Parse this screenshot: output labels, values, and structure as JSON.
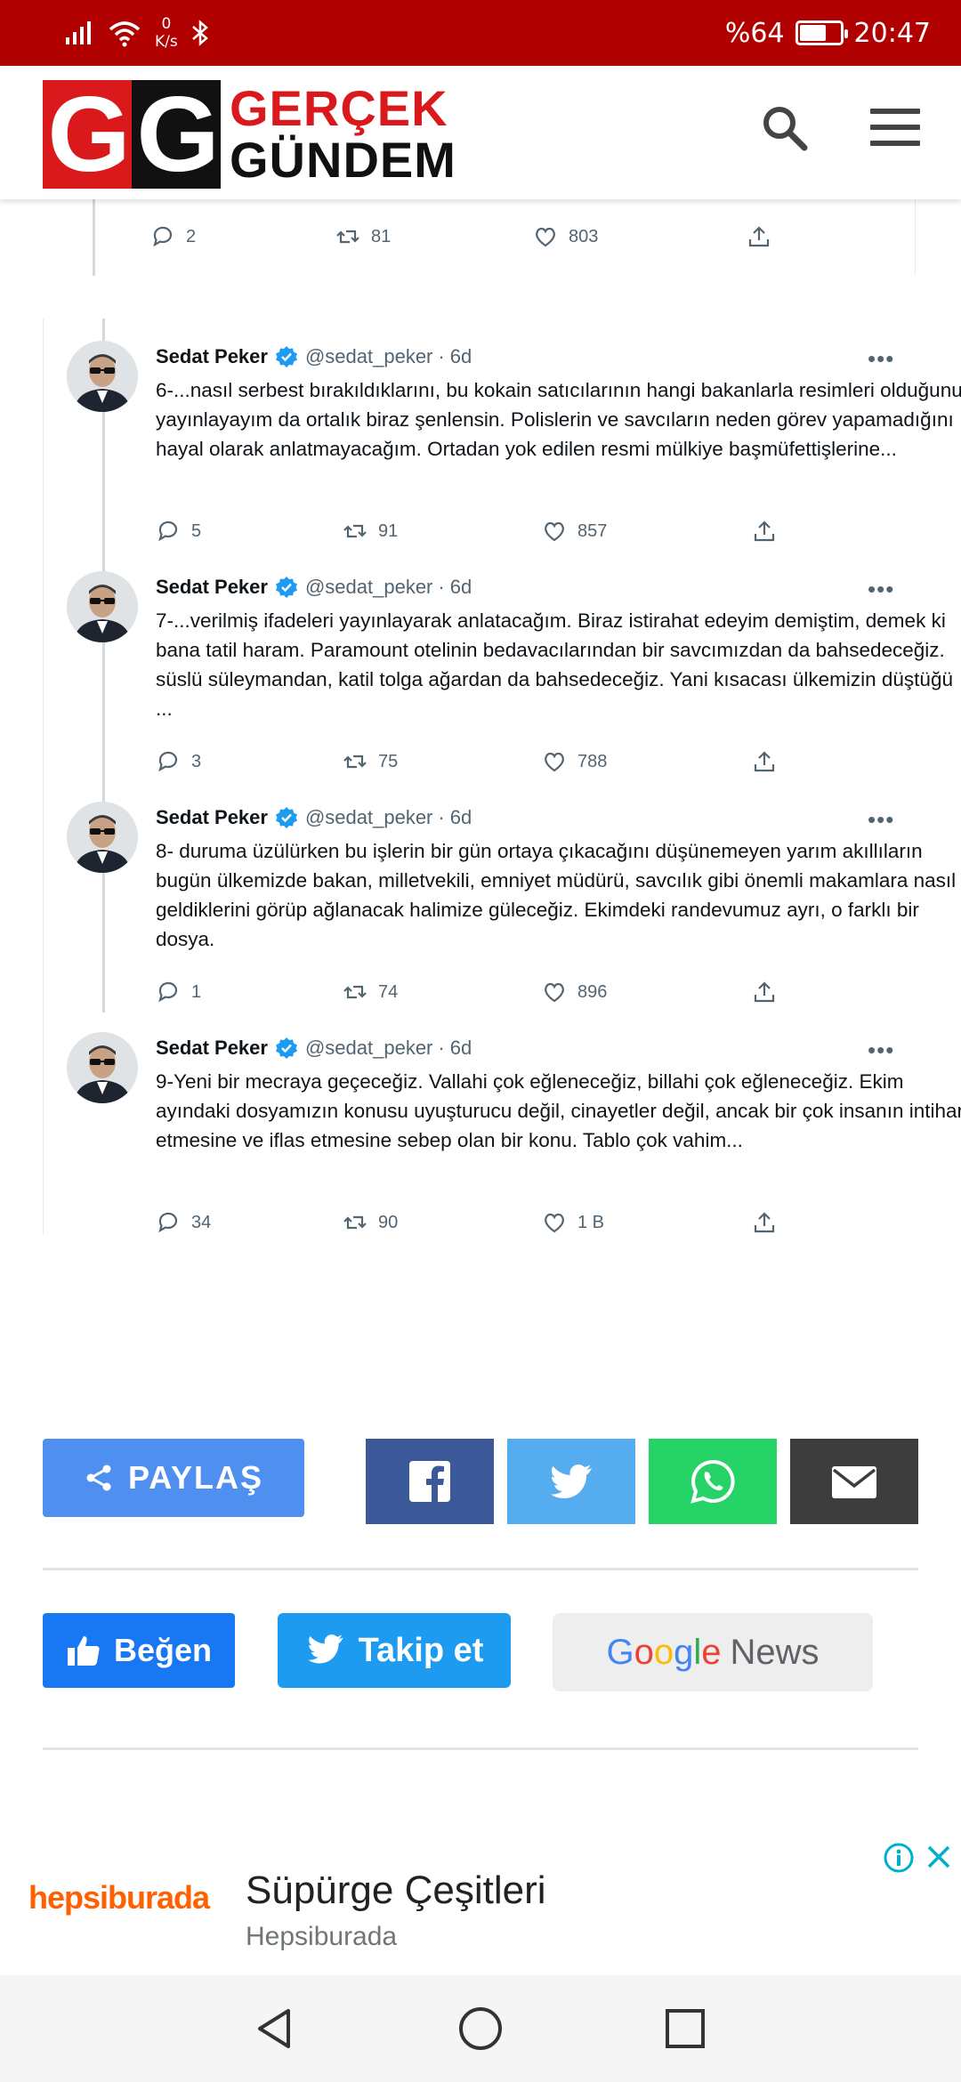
{
  "status_bar": {
    "net_speed_value": "0",
    "net_speed_unit": "K/s",
    "battery_percent": "%64",
    "battery_level": 0.64,
    "time": "20:47"
  },
  "header": {
    "logo_mark": "GG",
    "logo_line1": "GERÇEK",
    "logo_line2": "GÜNDEM",
    "search_icon": "search-icon",
    "menu_icon": "hamburger-menu-icon"
  },
  "top_tweet_actions": {
    "replies": "2",
    "retweets": "81",
    "likes": "803"
  },
  "tweets": [
    {
      "name": "Sedat Peker",
      "handle": "@sedat_peker",
      "separator": "·",
      "time": "6d",
      "text": "6-...nasıl serbest bırakıldıklarını, bu kokain satıcılarının hangi bakanlarla resimleri olduğunu yayınlayayım da ortalık biraz şenlensin. Polislerin ve savcıların neden görev yapamadığını hayal olarak anlatmayacağım. Ortadan yok edilen resmi mülkiye başmüfettişlerine...",
      "replies": "5",
      "retweets": "91",
      "likes": "857"
    },
    {
      "name": "Sedat Peker",
      "handle": "@sedat_peker",
      "separator": "·",
      "time": "6d",
      "text": "7-...verilmiş ifadeleri yayınlayarak anlatacağım. Biraz istirahat edeyim demiştim, demek ki bana tatil haram. Paramount otelinin bedavacılarından bir savcımızdan da bahsedeceğiz. süslü süleymandan, katil tolga ağardan da bahsedeceğiz. Yani kısacası ülkemizin düştüğü ...",
      "replies": "3",
      "retweets": "75",
      "likes": "788"
    },
    {
      "name": "Sedat Peker",
      "handle": "@sedat_peker",
      "separator": "·",
      "time": "6d",
      "text": "8- duruma üzülürken bu işlerin bir gün ortaya çıkacağını düşünemeyen yarım akıllıların bugün ülkemizde bakan, milletvekili, emniyet müdürü, savcılık gibi önemli makamlara nasıl geldiklerini görüp ağlanacak halimize güleceğiz. Ekimdeki randevumuz ayrı, o farklı bir dosya.",
      "replies": "1",
      "retweets": "74",
      "likes": "896"
    },
    {
      "name": "Sedat Peker",
      "handle": "@sedat_peker",
      "separator": "·",
      "time": "6d",
      "text": "9-Yeni bir mecraya geçeceğiz. Vallahi çok eğleneceğiz, billahi çok eğleneceğiz. Ekim ayındaki dosyamızın konusu uyuşturucu değil, cinayetler değil, ancak bir çok insanın intihar etmesine ve iflas etmesine sebep olan bir konu. Tablo çok vahim...",
      "replies": "34",
      "retweets": "90",
      "likes": "1 B"
    }
  ],
  "share": {
    "label": "PAYLAŞ",
    "facebook_color": "#3b5998",
    "twitter_color": "#55acee",
    "whatsapp_color": "#25d366",
    "email_color": "#3d3d3d"
  },
  "follow": {
    "like_label": "Beğen",
    "follow_label": "Takip et",
    "google_g": "G",
    "google_o1": "o",
    "google_o2": "o",
    "google_g2": "g",
    "google_l": "l",
    "google_e": "e",
    "news_label": "News"
  },
  "ad": {
    "brand": "hepsiburada",
    "title": "Süpürge Çeşitleri",
    "subtitle": "Hepsiburada"
  },
  "colors": {
    "status_bar": "#b00000",
    "brand_red": "#d9191c",
    "twitter_verified": "#1d9bf0"
  }
}
